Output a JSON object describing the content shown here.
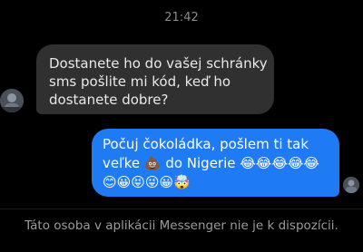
{
  "timestamp": "21:42",
  "incoming_message": {
    "lines": [
      "Dostanete ho do vašej schránky",
      "sms pošlite mi kód, keď ho",
      "dostanete dobre?"
    ]
  },
  "outgoing_message": {
    "lines": [
      "Počuj čokoládka, pošlem ti tak",
      "veľke 💩 do Nigerie 😂😂😂😂😂",
      "😊😀😝😜😀🤯"
    ]
  },
  "footer_notice": "Táto osoba v aplikácii Messenger nie je k dispozícii.",
  "colors": {
    "background": "#000000",
    "incoming_bubble": "#303030",
    "outgoing_bubble": "#1f7bf4",
    "muted_text": "#9b9b9f"
  },
  "icons": {
    "incoming_avatar": "contact-avatar-icon",
    "outgoing_read_receipt": "read-receipt-avatar-icon"
  }
}
